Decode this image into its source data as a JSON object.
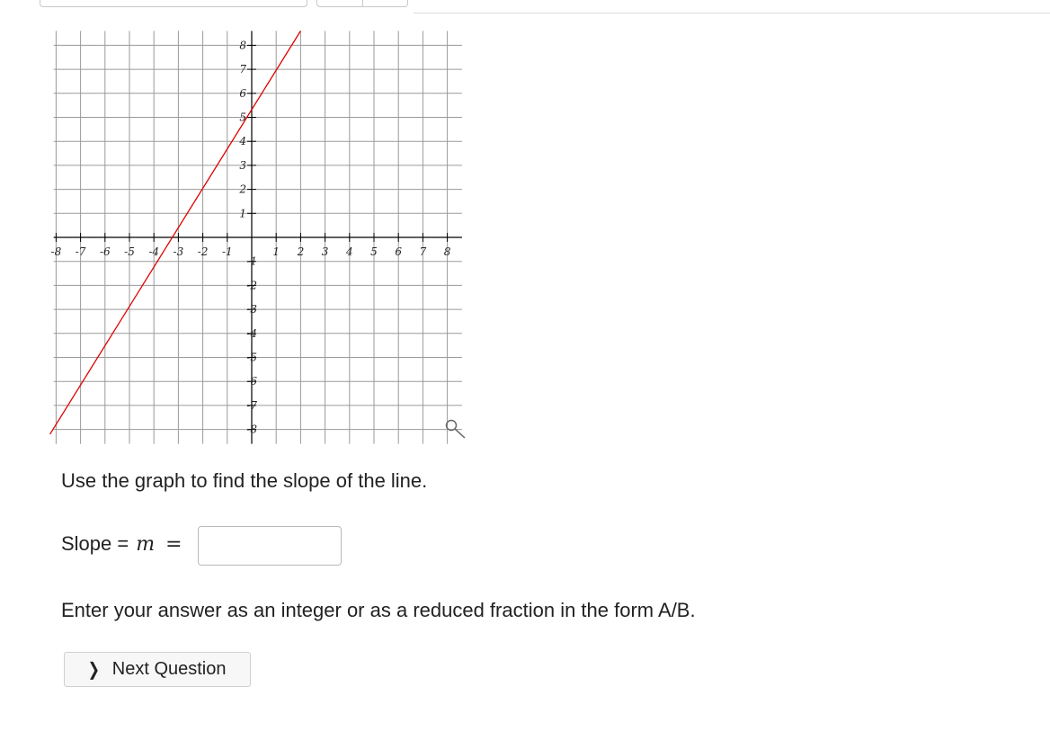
{
  "graph": {
    "x_ticks": [
      "-8",
      "-7",
      "-6",
      "-5",
      "-4",
      "-3",
      "-2",
      "-1",
      "1",
      "2",
      "3",
      "4",
      "5",
      "6",
      "7",
      "8"
    ],
    "y_ticks_pos": [
      "8",
      "7",
      "6",
      "5",
      "4",
      "3",
      "2",
      "1"
    ],
    "y_ticks_neg": [
      "-1",
      "-2",
      "-3",
      "-4",
      "-5",
      "-6",
      "-7",
      "-8"
    ],
    "line_color": "#e00000",
    "line_points": [
      [
        -8.25,
        -8.2
      ],
      [
        2.0,
        8.6
      ]
    ],
    "zoom_icon": "magnifier-icon"
  },
  "prompt": "Use the graph to find the slope of the line.",
  "slope": {
    "label": "Slope = ",
    "var": "m",
    "equals": "=",
    "value": ""
  },
  "hint": "Enter your answer as an integer or as a reduced fraction in the form A/B.",
  "next_button": {
    "chevron": "❯",
    "label": "Next Question"
  }
}
